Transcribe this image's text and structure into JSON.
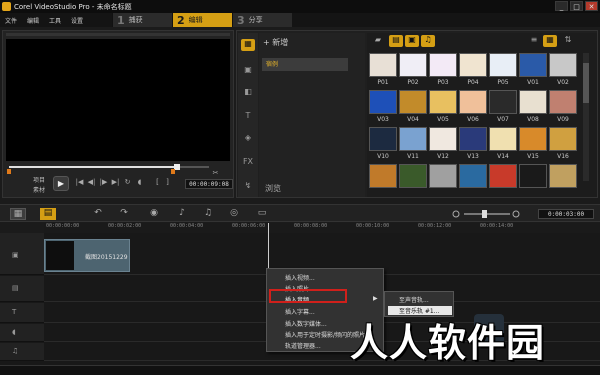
{
  "window": {
    "title": "Corel VideoStudio Pro - 未命名标题"
  },
  "menu": [
    "文件",
    "编辑",
    "工具",
    "设置"
  ],
  "steps": [
    {
      "num": "1",
      "label": "捕获"
    },
    {
      "num": "2",
      "label": "编辑"
    },
    {
      "num": "3",
      "label": "分享"
    }
  ],
  "preview": {
    "project_label": "项目",
    "clip_label": "素材",
    "timecode": "00:00:09:08",
    "scrub_progress": 0.84
  },
  "library": {
    "add_label": "+ 新增",
    "folder_name": "宿例",
    "browse_label": "浏览",
    "thumbnails": [
      "P01",
      "P02",
      "P03",
      "P04",
      "P05",
      "V01",
      "V02",
      "V03",
      "V04",
      "V05",
      "V06",
      "V07",
      "V08",
      "V09",
      "V10",
      "V11",
      "V12",
      "V13",
      "V14",
      "V15",
      "V16",
      "",
      "",
      "",
      "",
      "",
      "",
      ""
    ],
    "thumb_colors": [
      "#e8e0d6",
      "#f0eef6",
      "#f3eaf6",
      "#f0e4d0",
      "#e8eef6",
      "#2a5aa8",
      "#c8c8c8",
      "#1e50b8",
      "#c28b2a",
      "#e8c060",
      "#f0c09a",
      "#2a2a2a",
      "#e8e0d0",
      "#c08070",
      "#1c2a40",
      "#7aa2d0",
      "#f0e8e0",
      "#2a3a7a",
      "#f0e0b0",
      "#d88a2a",
      "#d0a040",
      "#c07a2a",
      "#3a5a2a",
      "#a0a0a0",
      "#2a6aa0",
      "#c83a2a",
      "#1a1a1a",
      "#c0a060"
    ]
  },
  "timeline": {
    "timecode": "0:00:03:00",
    "ruler": [
      "00:00:00:00",
      "00:00:02:00",
      "00:00:04:00",
      "00:00:06:00",
      "00:00:08:00",
      "00:00:10:00",
      "00:00:12:00",
      "00:00:14:00"
    ],
    "clip_label": "截图20151229"
  },
  "context_menu": {
    "items": [
      "插入视频...",
      "插入照片...",
      "插入音频",
      "插入字幕...",
      "插入数字媒体...",
      "插入用于定时摄影/频闪的照片...",
      "轨道管理器..."
    ],
    "submenu": [
      "至声音轨...",
      "至音乐轨 #1..."
    ]
  },
  "watermark": {
    "text": "人人软件园"
  }
}
